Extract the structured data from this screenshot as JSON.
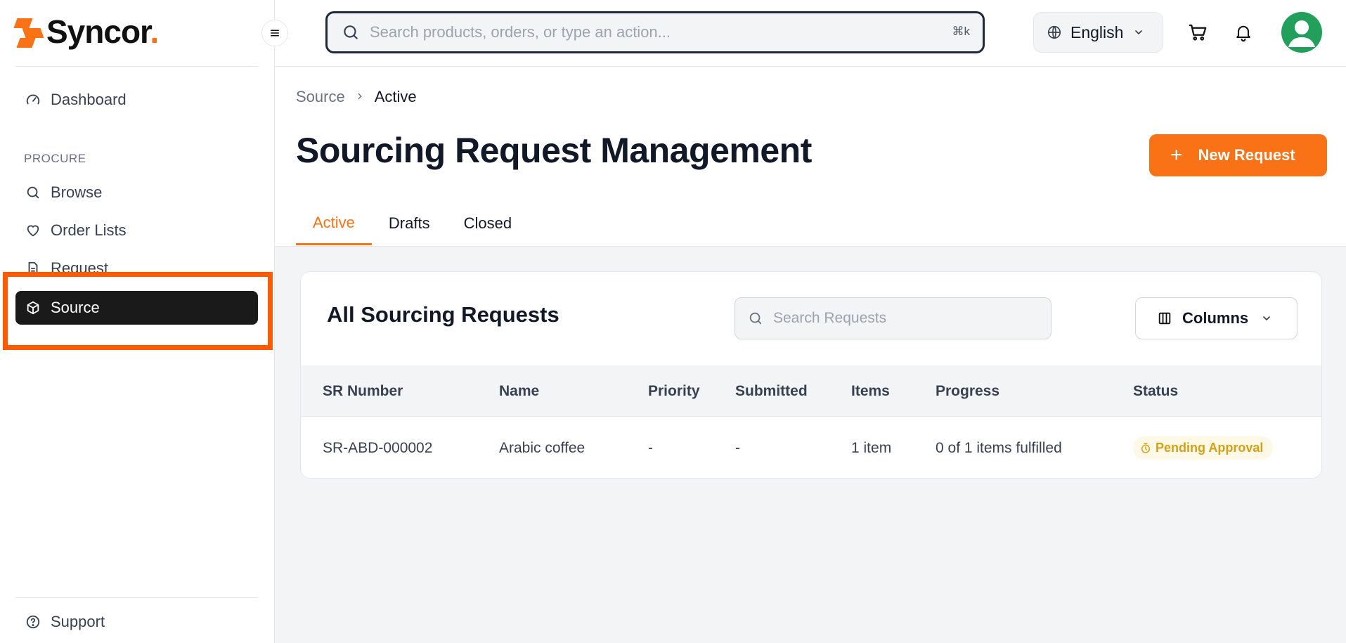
{
  "brand": {
    "name": "Syncor",
    "dot": "."
  },
  "sidebar": {
    "dashboard": "Dashboard",
    "section_label": "PROCURE",
    "items": [
      {
        "label": "Browse",
        "icon": "search-icon"
      },
      {
        "label": "Order Lists",
        "icon": "heart-icon"
      },
      {
        "label": "Request",
        "icon": "document-icon"
      },
      {
        "label": "Source",
        "icon": "box-icon",
        "active": true
      }
    ],
    "support": "Support"
  },
  "topbar": {
    "search_placeholder": "Search products, orders, or type an action...",
    "shortcut": "⌘k",
    "language": "English"
  },
  "breadcrumb": {
    "parent": "Source",
    "current": "Active"
  },
  "page": {
    "title": "Sourcing Request Management",
    "new_button": "New Request",
    "tabs": [
      "Active",
      "Drafts",
      "Closed"
    ],
    "active_tab": "Active"
  },
  "card": {
    "title": "All Sourcing Requests",
    "search_placeholder": "Search Requests",
    "columns_button": "Columns"
  },
  "table": {
    "headers": [
      "SR Number",
      "Name",
      "Priority",
      "Submitted",
      "Items",
      "Progress",
      "Status"
    ],
    "rows": [
      {
        "sr_number": "SR-ABD-000002",
        "name": "Arabic coffee",
        "priority": "-",
        "submitted": "-",
        "items": "1 item",
        "progress": "0 of 1 items fulfilled",
        "status": "Pending Approval"
      }
    ]
  },
  "colors": {
    "accent": "#f97316",
    "active_nav": "#1a1a1a",
    "highlight": "#ff5a00",
    "status_pending": "#d4a017"
  }
}
